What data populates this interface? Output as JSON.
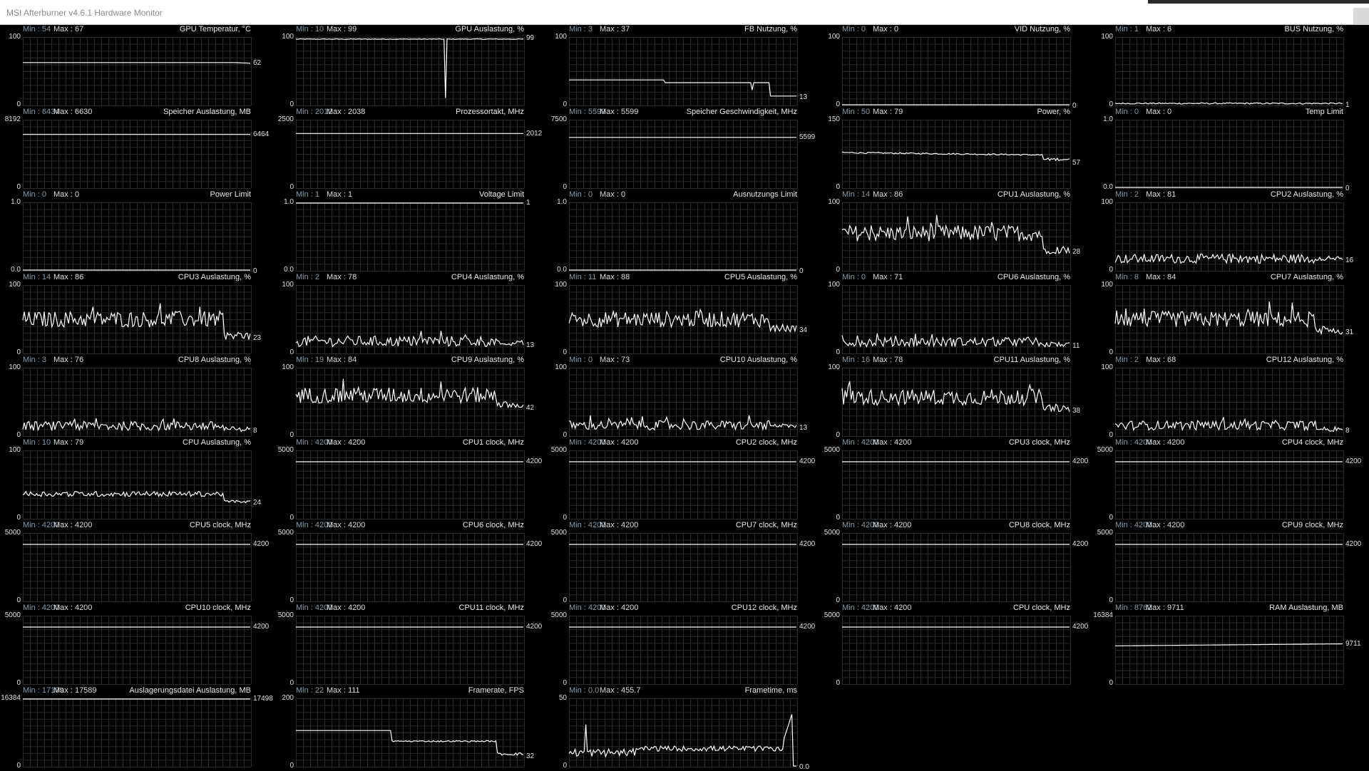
{
  "window": {
    "title": "MSI Afterburner v4.6.1 Hardware Monitor"
  },
  "colors": {
    "background": "#000000",
    "grid": "#2b2b2b",
    "line": "#ffffff",
    "min_label": "#8a9aa8"
  },
  "graphs": [
    {
      "name": "GPU Temperatur, °C",
      "min": "Min : 54",
      "max": "Max : 67",
      "ymax": "100",
      "ymin": "0",
      "cur": "62",
      "shape": "flat",
      "v": 0.63,
      "end": 0.62
    },
    {
      "name": "GPU Auslastung, %",
      "min": "Min : 10",
      "max": "Max : 99",
      "ymax": "100",
      "ymin": "0",
      "cur": "99",
      "shape": "gpuload",
      "v": 0.98,
      "end": 0.99
    },
    {
      "name": "FB Nutzung, %",
      "min": "Min : 3",
      "max": "Max : 37",
      "ymax": "100",
      "ymin": "0",
      "cur": "13",
      "shape": "fb",
      "v": 0.37,
      "end": 0.13
    },
    {
      "name": "VID Nutzung, %",
      "min": "Min : 0",
      "max": "Max : 0",
      "ymax": "100",
      "ymin": "0",
      "cur": "0",
      "shape": "flat",
      "v": 0.0,
      "end": 0.0
    },
    {
      "name": "BUS Nutzung, %",
      "min": "Min : 1",
      "max": "Max : 6",
      "ymax": "100",
      "ymin": "0",
      "cur": "1",
      "shape": "bus",
      "v": 0.02,
      "end": 0.01
    },
    {
      "name": "Speicher Auslastung, MB",
      "min": "Min : 6434",
      "max": "Max : 6630",
      "ymax": "8192",
      "ymin": "0",
      "cur": "6464",
      "shape": "flat",
      "v": 0.79,
      "end": 0.79
    },
    {
      "name": "Prozessortakt, MHz",
      "min": "Min : 2012",
      "max": "Max : 2038",
      "ymax": "2500",
      "ymin": "0",
      "cur": "2012",
      "shape": "flat",
      "v": 0.805,
      "end": 0.805
    },
    {
      "name": "Speicher Geschwindigkeit, MHz",
      "min": "Min : 5599",
      "max": "Max : 5599",
      "ymax": "7500",
      "ymin": "0",
      "cur": "5599",
      "shape": "flat",
      "v": 0.747,
      "end": 0.747
    },
    {
      "name": "Power, %",
      "min": "Min : 50",
      "max": "Max : 79",
      "ymax": "150",
      "ymin": "0",
      "cur": "57",
      "shape": "power",
      "v": 0.52,
      "end": 0.38
    },
    {
      "name": "Temp Limit",
      "min": "Min : 0",
      "max": "Max : 0",
      "ymax": "1.0",
      "ymin": "0.0",
      "cur": "0",
      "shape": "flat",
      "v": 0.0,
      "end": 0.0
    },
    {
      "name": "Power Limit",
      "min": "Min : 0",
      "max": "Max : 0",
      "ymax": "1.0",
      "ymin": "0.0",
      "cur": "0",
      "shape": "flat",
      "v": 0.0,
      "end": 0.0
    },
    {
      "name": "Voltage Limit",
      "min": "Min : 1",
      "max": "Max : 1",
      "ymax": "1.0",
      "ymin": "0.0",
      "cur": "1",
      "shape": "flat",
      "v": 1.0,
      "end": 1.0
    },
    {
      "name": "Ausnutzungs Limit",
      "min": "Min : 0",
      "max": "Max : 0",
      "ymax": "1.0",
      "ymin": "0.0",
      "cur": "0",
      "shape": "flat",
      "v": 0.0,
      "end": 0.0
    },
    {
      "name": "CPU1 Auslastung, %",
      "min": "Min : 14",
      "max": "Max : 86",
      "ymax": "100",
      "ymin": "0",
      "cur": "28",
      "shape": "noise",
      "v": 0.55,
      "end": 0.28,
      "amp": 0.12
    },
    {
      "name": "CPU2 Auslastung, %",
      "min": "Min : 2",
      "max": "Max : 81",
      "ymax": "100",
      "ymin": "0",
      "cur": "16",
      "shape": "noise",
      "v": 0.17,
      "end": 0.16,
      "amp": 0.07
    },
    {
      "name": "CPU3 Auslastung, %",
      "min": "Min : 14",
      "max": "Max : 86",
      "ymax": "100",
      "ymin": "0",
      "cur": "23",
      "shape": "noise",
      "v": 0.5,
      "end": 0.23,
      "amp": 0.12
    },
    {
      "name": "CPU4 Auslastung, %",
      "min": "Min : 2",
      "max": "Max : 78",
      "ymax": "100",
      "ymin": "0",
      "cur": "13",
      "shape": "noise",
      "v": 0.17,
      "end": 0.13,
      "amp": 0.08
    },
    {
      "name": "CPU5 Auslastung, %",
      "min": "Min : 11",
      "max": "Max : 88",
      "ymax": "100",
      "ymin": "0",
      "cur": "34",
      "shape": "noise",
      "v": 0.5,
      "end": 0.34,
      "amp": 0.12
    },
    {
      "name": "CPU6 Auslastung, %",
      "min": "Min : 0",
      "max": "Max : 71",
      "ymax": "100",
      "ymin": "0",
      "cur": "11",
      "shape": "noise",
      "v": 0.16,
      "end": 0.11,
      "amp": 0.07
    },
    {
      "name": "CPU7 Auslastung, %",
      "min": "Min : 8",
      "max": "Max : 84",
      "ymax": "100",
      "ymin": "0",
      "cur": "31",
      "shape": "noise",
      "v": 0.5,
      "end": 0.31,
      "amp": 0.12
    },
    {
      "name": "CPU8 Auslastung, %",
      "min": "Min : 3",
      "max": "Max : 76",
      "ymax": "100",
      "ymin": "0",
      "cur": "8",
      "shape": "noise",
      "v": 0.14,
      "end": 0.08,
      "amp": 0.07
    },
    {
      "name": "CPU9 Auslastung, %",
      "min": "Min : 19",
      "max": "Max : 84",
      "ymax": "100",
      "ymin": "0",
      "cur": "42",
      "shape": "noise",
      "v": 0.6,
      "end": 0.42,
      "amp": 0.12
    },
    {
      "name": "CPU10 Auslastung, %",
      "min": "Min : 0",
      "max": "Max : 73",
      "ymax": "100",
      "ymin": "0",
      "cur": "13",
      "shape": "noise",
      "v": 0.15,
      "end": 0.13,
      "amp": 0.07
    },
    {
      "name": "CPU11 Auslastung, %",
      "min": "Min : 16",
      "max": "Max : 78",
      "ymax": "100",
      "ymin": "0",
      "cur": "38",
      "shape": "noise",
      "v": 0.57,
      "end": 0.38,
      "amp": 0.12
    },
    {
      "name": "CPU12 Auslastung, %",
      "min": "Min : 2",
      "max": "Max : 68",
      "ymax": "100",
      "ymin": "0",
      "cur": "8",
      "shape": "noise",
      "v": 0.15,
      "end": 0.08,
      "amp": 0.07
    },
    {
      "name": "CPU Auslastung, %",
      "min": "Min : 10",
      "max": "Max : 79",
      "ymax": "100",
      "ymin": "0",
      "cur": "24",
      "shape": "noise",
      "v": 0.36,
      "end": 0.24,
      "amp": 0.04
    },
    {
      "name": "CPU1 clock, MHz",
      "min": "Min : 4200",
      "max": "Max : 4200",
      "ymax": "5000",
      "ymin": "0",
      "cur": "4200",
      "shape": "flat",
      "v": 0.84,
      "end": 0.84
    },
    {
      "name": "CPU2 clock, MHz",
      "min": "Min : 4200",
      "max": "Max : 4200",
      "ymax": "5000",
      "ymin": "0",
      "cur": "4200",
      "shape": "flat",
      "v": 0.84,
      "end": 0.84
    },
    {
      "name": "CPU3 clock, MHz",
      "min": "Min : 4200",
      "max": "Max : 4200",
      "ymax": "5000",
      "ymin": "0",
      "cur": "4200",
      "shape": "flat",
      "v": 0.84,
      "end": 0.84
    },
    {
      "name": "CPU4 clock, MHz",
      "min": "Min : 4200",
      "max": "Max : 4200",
      "ymax": "5000",
      "ymin": "0",
      "cur": "4200",
      "shape": "flat",
      "v": 0.84,
      "end": 0.84
    },
    {
      "name": "CPU5 clock, MHz",
      "min": "Min : 4200",
      "max": "Max : 4200",
      "ymax": "5000",
      "ymin": "0",
      "cur": "4200",
      "shape": "flat",
      "v": 0.84,
      "end": 0.84
    },
    {
      "name": "CPU6 clock, MHz",
      "min": "Min : 4200",
      "max": "Max : 4200",
      "ymax": "5000",
      "ymin": "0",
      "cur": "4200",
      "shape": "flat",
      "v": 0.84,
      "end": 0.84
    },
    {
      "name": "CPU7 clock, MHz",
      "min": "Min : 4200",
      "max": "Max : 4200",
      "ymax": "5000",
      "ymin": "0",
      "cur": "4200",
      "shape": "flat",
      "v": 0.84,
      "end": 0.84
    },
    {
      "name": "CPU8 clock, MHz",
      "min": "Min : 4200",
      "max": "Max : 4200",
      "ymax": "5000",
      "ymin": "0",
      "cur": "4200",
      "shape": "flat",
      "v": 0.84,
      "end": 0.84
    },
    {
      "name": "CPU9 clock, MHz",
      "min": "Min : 4200",
      "max": "Max : 4200",
      "ymax": "5000",
      "ymin": "0",
      "cur": "4200",
      "shape": "flat",
      "v": 0.84,
      "end": 0.84
    },
    {
      "name": "CPU10 clock, MHz",
      "min": "Min : 4200",
      "max": "Max : 4200",
      "ymax": "5000",
      "ymin": "0",
      "cur": "4200",
      "shape": "flat",
      "v": 0.84,
      "end": 0.84
    },
    {
      "name": "CPU11 clock, MHz",
      "min": "Min : 4200",
      "max": "Max : 4200",
      "ymax": "5000",
      "ymin": "0",
      "cur": "4200",
      "shape": "flat",
      "v": 0.84,
      "end": 0.84
    },
    {
      "name": "CPU12 clock, MHz",
      "min": "Min : 4200",
      "max": "Max : 4200",
      "ymax": "5000",
      "ymin": "0",
      "cur": "4200",
      "shape": "flat",
      "v": 0.84,
      "end": 0.84
    },
    {
      "name": "CPU clock, MHz",
      "min": "Min : 4200",
      "max": "Max : 4200",
      "ymax": "5000",
      "ymin": "0",
      "cur": "4200",
      "shape": "flat",
      "v": 0.84,
      "end": 0.84
    },
    {
      "name": "RAM Auslastung, MB",
      "min": "Min : 8762",
      "max": "Max : 9711",
      "ymax": "16384",
      "ymin": "0",
      "cur": "9711",
      "shape": "ram",
      "v": 0.56,
      "end": 0.59
    },
    {
      "name": "Auslagerungsdatei Auslastung, MB",
      "min": "Min : 17199",
      "max": "Max : 17589",
      "ymax": "16384",
      "ymin": "0",
      "cur": "17498",
      "shape": "flat",
      "v": 1.0,
      "end": 1.0
    },
    {
      "name": "Framerate, FPS",
      "min": "Min : 22",
      "max": "Max : 111",
      "ymax": "200",
      "ymin": "0",
      "cur": "32",
      "shape": "fps",
      "v": 0.53,
      "end": 0.16
    },
    {
      "name": "Frametime, ms",
      "min": "Min : 0.0",
      "max": "Max : 455.7",
      "ymax": "50",
      "ymin": "0",
      "cur": "0.0",
      "shape": "frametime",
      "v": 0.25,
      "end": 0.0
    }
  ]
}
